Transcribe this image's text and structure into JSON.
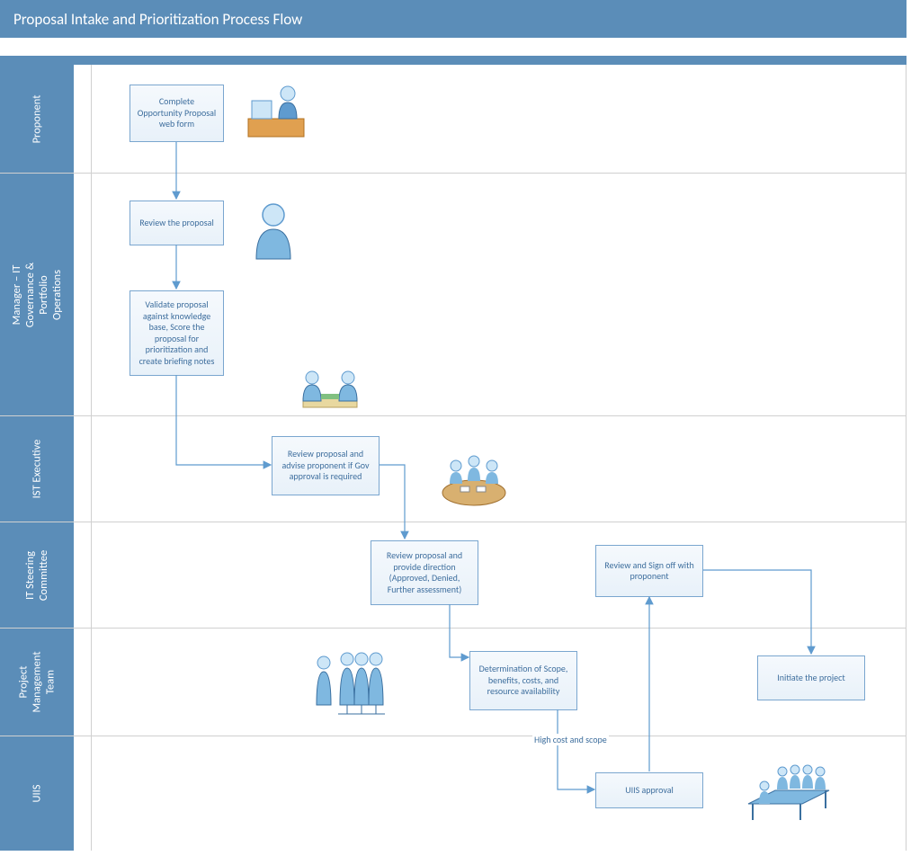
{
  "title": "Proposal Intake and Prioritization Process Flow",
  "lanes": {
    "proponent": "Proponent",
    "manager": "Manager – IT Governance & Portfolio Operations",
    "ist": "IST Executive",
    "steering": "IT Steering Committee",
    "pmt": "Project Management Team",
    "uiis": "UIIS"
  },
  "nodes": {
    "complete_form": "Complete Opportunity Proposal web form",
    "review_proposal": "Review the proposal",
    "validate": "Validate proposal against knowledge base, Score the proposal for prioritization and create briefing notes",
    "ist_review": "Review proposal and advise proponent if Gov approval is required",
    "steering_review": "Review proposal and provide direction (Approved, Denied, Further assessment)",
    "signoff": "Review and Sign off with proponent",
    "determination": "Determination of Scope, benefits, costs, and resource availability",
    "initiate": "Initiate the project",
    "uiis_approval": "UIIS approval"
  },
  "labels": {
    "high_cost": "High cost and scope"
  },
  "icons": {
    "proponent": "person-at-computer-icon",
    "manager": "person-icon",
    "handshake": "discussion-icon",
    "meeting": "meeting-table-icon",
    "group": "group-of-people-icon",
    "board": "boardroom-icon"
  },
  "colors": {
    "lane": "#5b8db8",
    "node_border": "#7aa6cf",
    "node_text": "#3f6f9e",
    "arrow": "#5f9bcf"
  }
}
